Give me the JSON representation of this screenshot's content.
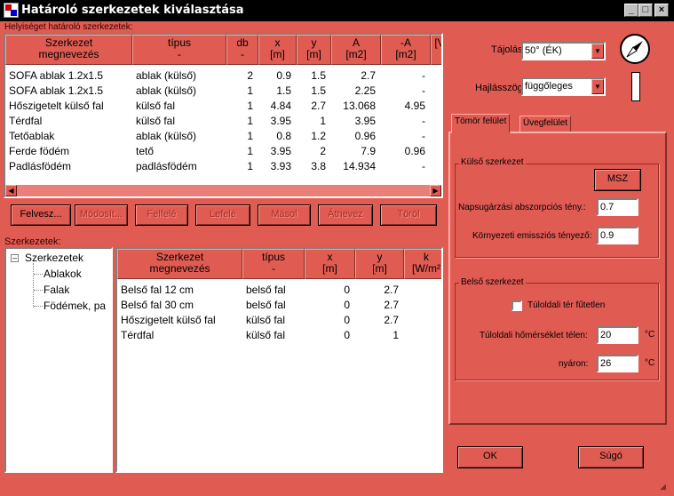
{
  "window": {
    "title": "Határoló szerkezetek kiválasztása",
    "logo_text": "Win"
  },
  "labels": {
    "room_structures": "Helyiséget határoló szerkezetek:",
    "structures": "Szerkezetek:"
  },
  "top_table": {
    "headers": [
      {
        "l1": "Szerkezet",
        "l2": "megnevezés"
      },
      {
        "l1": "típus",
        "l2": "-"
      },
      {
        "l1": "db",
        "l2": "-"
      },
      {
        "l1": "x",
        "l2": "[m]"
      },
      {
        "l1": "y",
        "l2": "[m]"
      },
      {
        "l1": "A",
        "l2": "[m2]"
      },
      {
        "l1": "-A",
        "l2": "[m2]"
      },
      {
        "l1": "",
        "l2": "[V"
      }
    ],
    "rows": [
      [
        "SOFA ablak 1.2x1.5",
        "ablak (külső)",
        "2",
        "0.9",
        "1.5",
        "2.7",
        "-"
      ],
      [
        "SOFA ablak 1.2x1.5",
        "ablak (külső)",
        "1",
        "1.5",
        "1.5",
        "2.25",
        "-"
      ],
      [
        "Hőszigetelt külső fal",
        "külső fal",
        "1",
        "4.84",
        "2.7",
        "13.068",
        "4.95"
      ],
      [
        "Térdfal",
        "külső fal",
        "1",
        "3.95",
        "1",
        "3.95",
        "-"
      ],
      [
        "Tetőablak",
        "ablak (külső)",
        "1",
        "0.8",
        "1.2",
        "0.96",
        "-"
      ],
      [
        "Ferde födém",
        "tető",
        "1",
        "3.95",
        "2",
        "7.9",
        "0.96"
      ],
      [
        "Padlásfödém",
        "padlásfödém",
        "1",
        "3.93",
        "3.8",
        "14.934",
        "-"
      ]
    ]
  },
  "buttons": {
    "search": "Felvesz...",
    "modify": "Módosít...",
    "up": "Felfelé",
    "down": "Lefelé",
    "copy": "Másol",
    "rename": "Átnevez",
    "delete": "Töröl",
    "ok": "OK",
    "help": "Súgó",
    "msz": "MSZ"
  },
  "tree": {
    "root": "Szerkezetek",
    "children": [
      "Ablakok",
      "Falak",
      "Födémek, pa"
    ]
  },
  "bottom_table": {
    "headers": [
      {
        "l1": "Szerkezet",
        "l2": "megnevezés"
      },
      {
        "l1": "típus",
        "l2": "-"
      },
      {
        "l1": "x",
        "l2": "[m]"
      },
      {
        "l1": "y",
        "l2": "[m]"
      },
      {
        "l1": "k",
        "l2": "[W/m²"
      }
    ],
    "rows": [
      [
        "Belső fal 12 cm",
        "belső fal",
        "0",
        "2.7"
      ],
      [
        "Belső fal 30 cm",
        "belső fal",
        "0",
        "2.7"
      ],
      [
        "Hőszigetelt külső fal",
        "külső fal",
        "0",
        "2.7"
      ],
      [
        "Térdfal",
        "külső fal",
        "0",
        "1"
      ]
    ]
  },
  "orientation": {
    "label": "Tájolás:",
    "value": "50° (ÉK)"
  },
  "tilt": {
    "label": "Hajlásszög:",
    "value": "függőleges"
  },
  "tabs": [
    "Tömör felület",
    "Üvegfelület"
  ],
  "outer": {
    "legend": "Külső szerkezet",
    "absorption_label": "Napsugárzási abszorpciós tény.:",
    "absorption_value": "0.7",
    "emission_label": "Környezeti emissziós tényező:",
    "emission_value": "0.9"
  },
  "inner": {
    "legend": "Belső szerkezet",
    "unheated_label": "Túloldali tér fűtetlen",
    "winter_label": "Túloldali hőmérséklet télen:",
    "winter_value": "20",
    "summer_label": "nyáron:",
    "summer_value": "26",
    "unit": "°C"
  },
  "colors": {
    "background": "#e05b52",
    "titlebar": "#000000"
  }
}
